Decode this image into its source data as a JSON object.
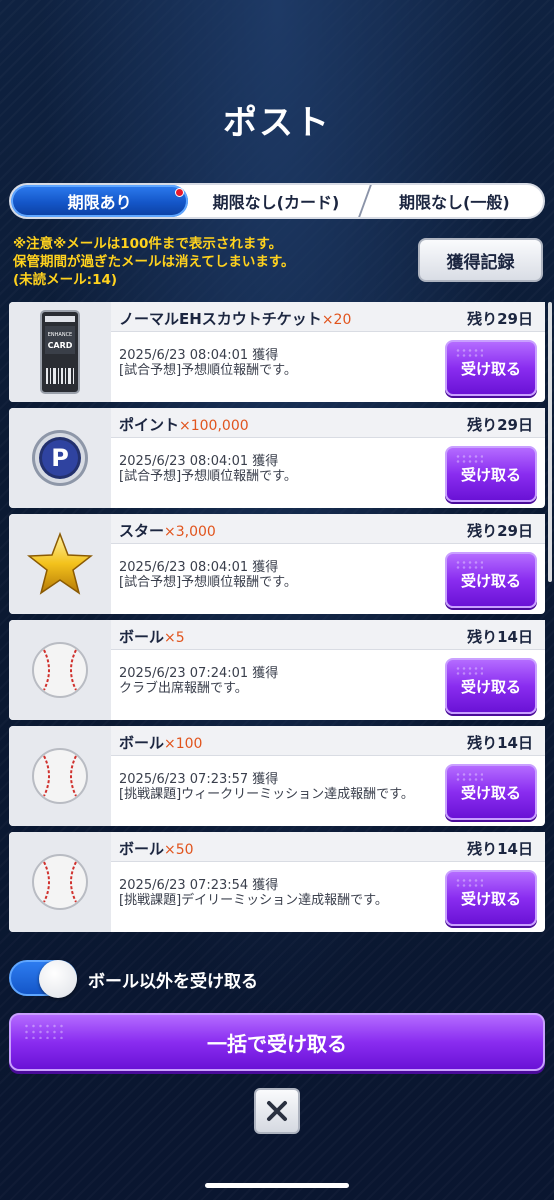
{
  "header": {
    "title": "ポスト"
  },
  "tabs": [
    {
      "label": "期限あり",
      "active": true,
      "has_badge": true
    },
    {
      "label": "期限なし(カード)",
      "active": false
    },
    {
      "label": "期限なし(一般)",
      "active": false
    }
  ],
  "notice": {
    "line1": "※注意※メールは100件まで表示されます。",
    "line2": "保管期間が過ぎたメールは消えてしまいます。",
    "line3": "(未読メール:14)"
  },
  "history_button": {
    "label": "獲得記録"
  },
  "mail_items": [
    {
      "icon": "enhance-card-icon",
      "name": "ノーマルEHスカウトチケット",
      "qty": "×20",
      "remaining": "残り29日",
      "date": "2025/6/23 08:04:01 獲得",
      "desc": "[試合予想]予想順位報酬です。",
      "button": "受け取る"
    },
    {
      "icon": "point-coin-icon",
      "name": "ポイント",
      "qty": "×100,000",
      "remaining": "残り29日",
      "date": "2025/6/23 08:04:01 獲得",
      "desc": "[試合予想]予想順位報酬です。",
      "button": "受け取る"
    },
    {
      "icon": "gold-star-icon",
      "name": "スター",
      "qty": "×3,000",
      "remaining": "残り29日",
      "date": "2025/6/23 08:04:01 獲得",
      "desc": "[試合予想]予想順位報酬です。",
      "button": "受け取る"
    },
    {
      "icon": "baseball-icon",
      "name": "ボール",
      "qty": "×5",
      "remaining": "残り14日",
      "date": "2025/6/23 07:24:01 獲得",
      "desc": "クラブ出席報酬です。",
      "button": "受け取る"
    },
    {
      "icon": "baseball-icon",
      "name": "ボール",
      "qty": "×100",
      "remaining": "残り14日",
      "date": "2025/6/23 07:23:57 獲得",
      "desc": "[挑戦課題]ウィークリーミッション達成報酬です。",
      "button": "受け取る"
    },
    {
      "icon": "baseball-icon",
      "name": "ボール",
      "qty": "×50",
      "remaining": "残り14日",
      "date": "2025/6/23 07:23:54 獲得",
      "desc": "[挑戦課題]デイリーミッション達成報酬です。",
      "button": "受け取る"
    }
  ],
  "toggle": {
    "label": "ボール以外を受け取る",
    "on": true
  },
  "bulk_button": {
    "label": "一括で受け取る"
  },
  "close_button": {
    "icon": "close-icon"
  },
  "colors": {
    "accent_blue": "#1456c8",
    "button_purple": "#8a2df0",
    "notice_yellow": "#ffd21e",
    "quantity_orange": "#e1541d"
  }
}
